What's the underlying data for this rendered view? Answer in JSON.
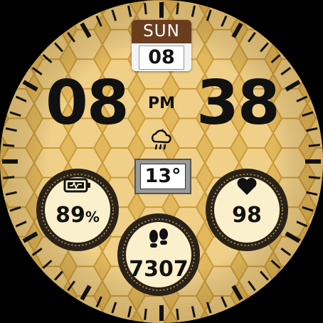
{
  "date": {
    "weekday": "SUN",
    "day": "08"
  },
  "time": {
    "hours": "08",
    "minutes": "38",
    "ampm": "PM"
  },
  "weather": {
    "icon": "cloud-moon-rain-icon",
    "temperature": "13°"
  },
  "battery": {
    "icon": "battery-icon",
    "value": "89",
    "unit": "%"
  },
  "heart_rate": {
    "icon": "heart-icon",
    "value": "98"
  },
  "steps": {
    "icon": "footsteps-icon",
    "value": "7307"
  },
  "colors": {
    "honey": "#e2b85c",
    "cell": "#f0d088",
    "comp_face": "#fbf0cc",
    "ring": "#2a2218",
    "date_header": "#6a3d1f",
    "text": "#111111"
  }
}
